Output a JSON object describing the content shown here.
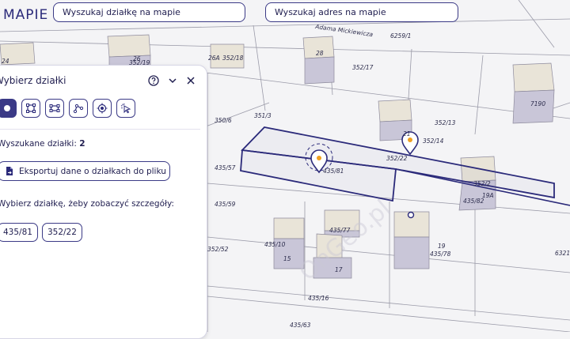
{
  "app": {
    "logo_text": "MAPIE"
  },
  "search": {
    "parcel_placeholder": "Wyszukaj działkę na mapie",
    "address_placeholder": "Wyszukaj adres na mapie"
  },
  "panel": {
    "title": "Wybierz działki",
    "tools": [
      "pointer-tool",
      "polygon-tool",
      "rectangle-tool",
      "line-tool",
      "circle-tool",
      "cursor-select-tool"
    ],
    "found_label": "Wyszukane działki:",
    "found_count": "2",
    "export_label": "Eksportuj dane o działkach do pliku",
    "hint": "Wybierz działkę, żeby zobaczyć szczegóły:",
    "parcels": [
      "435/81",
      "352/22"
    ]
  },
  "map": {
    "street_name": "Adama Mickiewicza",
    "parcel_numbers": [
      "24",
      "26",
      "352/19",
      "26A",
      "352/18",
      "28",
      "6259/1",
      "352/17",
      "350/6",
      "351/3",
      "352/13",
      "7190",
      "21",
      "352/14",
      "352/22",
      "435/57",
      "435/81",
      "352/2",
      "19A",
      "435/82",
      "435/59",
      "435/77",
      "19",
      "435/78",
      "435/10",
      "15",
      "17",
      "352/52",
      "435/16",
      "435/63",
      "6321"
    ],
    "watermark": "OnGeo.pl",
    "colors": {
      "selection": "#2b2a7a",
      "marker_dot": "#f0a020",
      "building_roof": "#e9e4d8",
      "building_wall": "#c9c6d8"
    }
  }
}
